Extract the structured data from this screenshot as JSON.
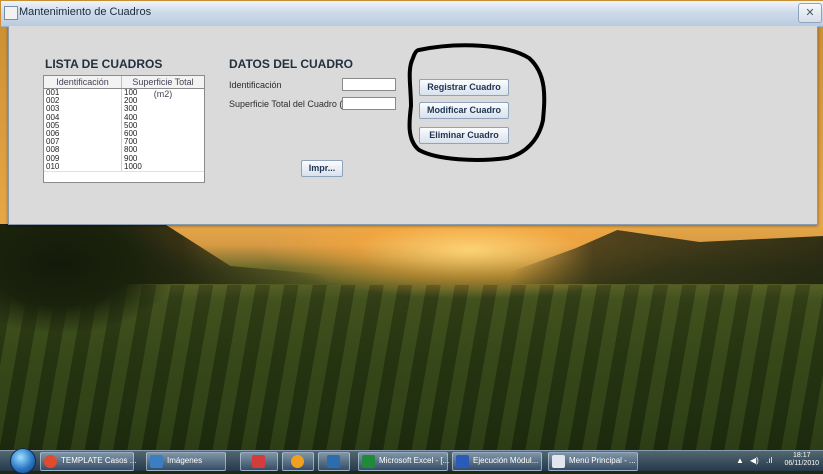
{
  "window": {
    "title": "Mantenimiento de Cuadros",
    "close_symbol": "✕"
  },
  "list": {
    "title": "LISTA DE CUADROS",
    "columns": [
      "Identificación",
      "Superficie Total (m2)"
    ],
    "rows": [
      [
        "001",
        "100"
      ],
      [
        "002",
        "200"
      ],
      [
        "003",
        "300"
      ],
      [
        "004",
        "400"
      ],
      [
        "005",
        "500"
      ],
      [
        "006",
        "600"
      ],
      [
        "007",
        "700"
      ],
      [
        "008",
        "800"
      ],
      [
        "009",
        "900"
      ],
      [
        "010",
        "1000"
      ]
    ]
  },
  "form": {
    "title": "DATOS DEL CUADRO",
    "id_label": "Identificación",
    "id_value": "",
    "area_label": "Superficie Total del Cuadro (m2)",
    "area_value": ""
  },
  "buttons": {
    "register": "Registrar Cuadro",
    "modify": "Modificar Cuadro",
    "delete": "Eliminar Cuadro",
    "print": "Impr..."
  },
  "taskbar": {
    "items": [
      {
        "label": "TEMPLATE Casos ...",
        "icon": "chrome-icon",
        "color": "#e04a2e"
      },
      {
        "label": "Imágenes",
        "icon": "folder-pictures-icon",
        "color": "#3a7fc1"
      },
      {
        "label": "",
        "icon": "paint-icon",
        "color": "#d23c3c"
      },
      {
        "label": "",
        "icon": "chrome-icon-2",
        "color": "#f0a020"
      },
      {
        "label": "",
        "icon": "network-icon",
        "color": "#2c6db0"
      },
      {
        "label": "Microsoft Excel - [...",
        "icon": "excel-icon",
        "color": "#1e8a3a"
      },
      {
        "label": "Ejecución Módul...",
        "icon": "word-icon",
        "color": "#2a5bb8"
      },
      {
        "label": "Menú Principal - ...",
        "icon": "java-icon",
        "color": "#e1e6ee"
      }
    ],
    "clock_time": "18:17",
    "clock_date": "06/11/2010",
    "tray_arrow": "▲",
    "tray_volume": "◀)",
    "tray_signal": ".ıl"
  }
}
